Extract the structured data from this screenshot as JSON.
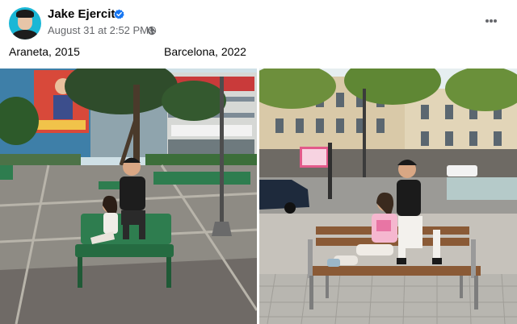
{
  "post": {
    "author": "Jake Ejercito",
    "verified": true,
    "timestamp": "August 31 at 2:52 PM",
    "separator": "·",
    "audience_icon": "globe-icon",
    "more_icon": "more-options-icon"
  },
  "captions": {
    "left": "Araneta, 2015",
    "right": "Barcelona, 2022"
  },
  "photos": [
    {
      "name": "photo-araneta-2015",
      "billboard_text": ""
    },
    {
      "name": "photo-barcelona-2022",
      "billboard_text": ""
    }
  ],
  "colors": {
    "verified": "#1877f2",
    "meta_text": "#65676b",
    "bench_green": "#2e7d4f",
    "bench_wood": "#8a5a36"
  }
}
